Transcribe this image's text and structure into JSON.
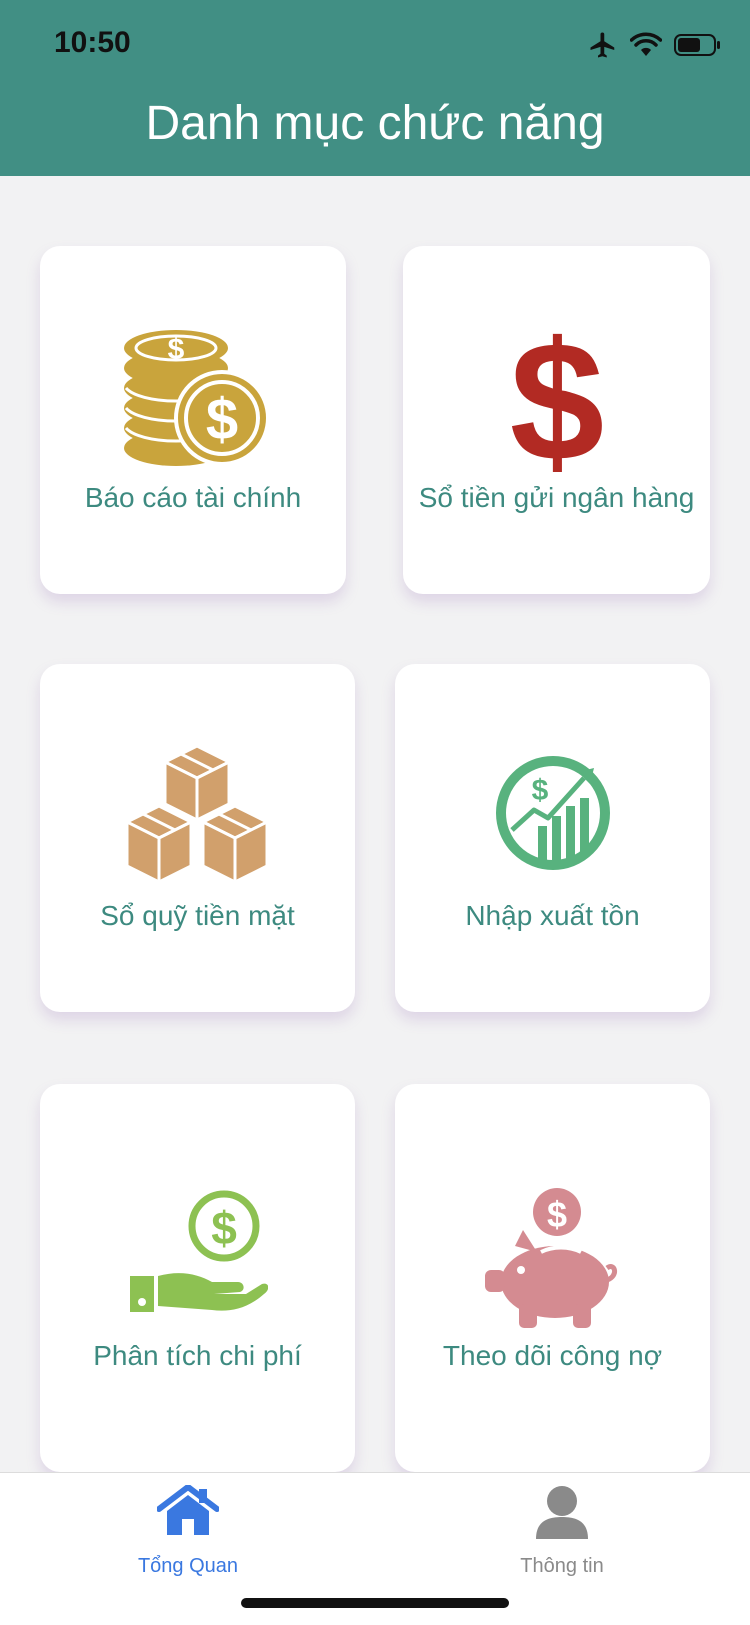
{
  "status_bar": {
    "time": "10:50"
  },
  "header": {
    "title": "Danh mục chức năng"
  },
  "cards": [
    {
      "label": "Báo cáo tài chính",
      "icon": "coins-icon",
      "color": "#c9a43c"
    },
    {
      "label": "Sổ tiền gửi ngân hàng",
      "icon": "dollar-sign-icon",
      "color": "#b22a23"
    },
    {
      "label": "Sổ quỹ tiền mặt",
      "icon": "boxes-icon",
      "color": "#d1a06c"
    },
    {
      "label": "Nhập xuất tồn",
      "icon": "growth-chart-icon",
      "color": "#58b27e"
    },
    {
      "label": "Phân tích chi phí",
      "icon": "hand-coin-icon",
      "color": "#8dc152"
    },
    {
      "label": "Theo dõi công nợ",
      "icon": "piggy-bank-icon",
      "color": "#d48b91"
    }
  ],
  "tabbar": {
    "tabs": [
      {
        "label": "Tổng Quan",
        "icon": "home-icon",
        "active": true
      },
      {
        "label": "Thông tin",
        "icon": "user-icon",
        "active": false
      }
    ],
    "active_color": "#3a78e0",
    "inactive_color": "#8a8a8a"
  },
  "colors": {
    "header": "#418f84",
    "label": "#3d8a80",
    "background": "#f2f2f3"
  }
}
